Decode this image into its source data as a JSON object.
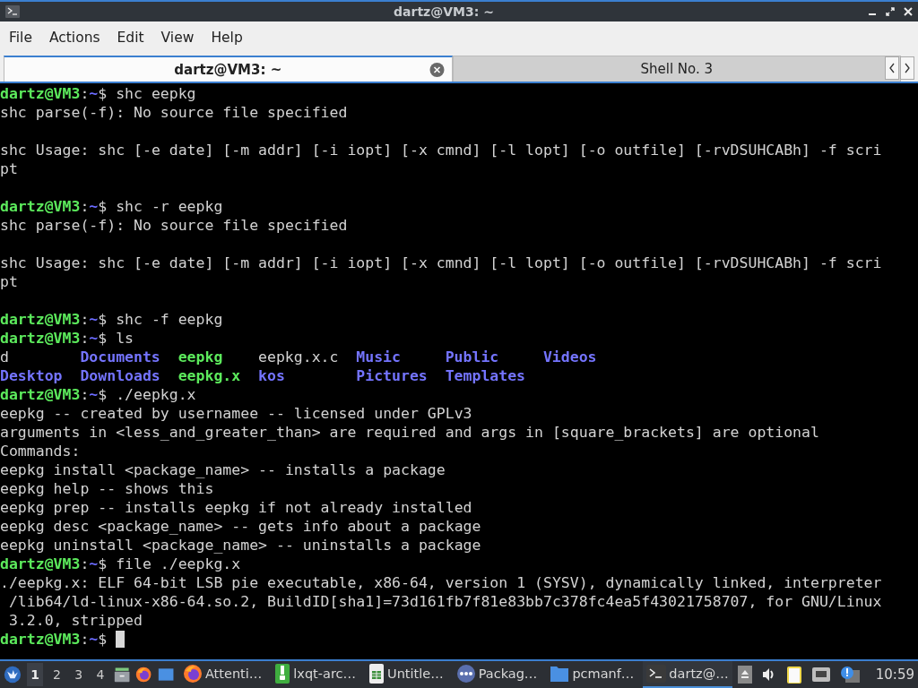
{
  "window": {
    "title": "dartz@VM3: ~"
  },
  "menu": [
    "File",
    "Actions",
    "Edit",
    "View",
    "Help"
  ],
  "tabs": [
    {
      "label": "dartz@VM3: ~",
      "selected": true
    },
    {
      "label": "Shell No. 3",
      "selected": false
    }
  ],
  "terminal": {
    "lines": [
      {
        "kind": "text",
        "segments": [
          {
            "t": "dartz@VM3",
            "kind": "user"
          },
          {
            "t": ":",
            "kind": "plain"
          },
          {
            "t": "~",
            "kind": "path"
          },
          {
            "t": "$ shc eepkg",
            "kind": "plain"
          }
        ]
      },
      {
        "kind": "text",
        "segments": [
          {
            "t": "shc parse(-f): No source file specified",
            "kind": "plain"
          }
        ]
      },
      {
        "kind": "blank"
      },
      {
        "kind": "text",
        "segments": [
          {
            "t": "shc Usage: shc [-e date] [-m addr] [-i iopt] [-x cmnd] [-l lopt] [-o outfile] [-rvDSUHCABh] -f scri",
            "kind": "plain"
          }
        ]
      },
      {
        "kind": "text",
        "segments": [
          {
            "t": "pt",
            "kind": "plain"
          }
        ]
      },
      {
        "kind": "blank"
      },
      {
        "kind": "text",
        "segments": [
          {
            "t": "dartz@VM3",
            "kind": "user"
          },
          {
            "t": ":",
            "kind": "plain"
          },
          {
            "t": "~",
            "kind": "path"
          },
          {
            "t": "$ shc -r eepkg",
            "kind": "plain"
          }
        ]
      },
      {
        "kind": "text",
        "segments": [
          {
            "t": "shc parse(-f): No source file specified",
            "kind": "plain"
          }
        ]
      },
      {
        "kind": "blank"
      },
      {
        "kind": "text",
        "segments": [
          {
            "t": "shc Usage: shc [-e date] [-m addr] [-i iopt] [-x cmnd] [-l lopt] [-o outfile] [-rvDSUHCABh] -f scri",
            "kind": "plain"
          }
        ]
      },
      {
        "kind": "text",
        "segments": [
          {
            "t": "pt",
            "kind": "plain"
          }
        ]
      },
      {
        "kind": "blank"
      },
      {
        "kind": "text",
        "segments": [
          {
            "t": "dartz@VM3",
            "kind": "user"
          },
          {
            "t": ":",
            "kind": "plain"
          },
          {
            "t": "~",
            "kind": "path"
          },
          {
            "t": "$ shc -f eepkg",
            "kind": "plain"
          }
        ]
      },
      {
        "kind": "text",
        "segments": [
          {
            "t": "dartz@VM3",
            "kind": "user"
          },
          {
            "t": ":",
            "kind": "plain"
          },
          {
            "t": "~",
            "kind": "path"
          },
          {
            "t": "$ ls",
            "kind": "plain"
          }
        ]
      },
      {
        "kind": "columns",
        "segments": [
          {
            "t": "d",
            "kind": "plain"
          },
          {
            "t": "Documents",
            "kind": "dir"
          },
          {
            "t": "eepkg",
            "kind": "exec"
          },
          {
            "t": "eepkg.x.c",
            "kind": "plain"
          },
          {
            "t": "Music",
            "kind": "dir"
          },
          {
            "t": "Public",
            "kind": "dir"
          },
          {
            "t": "Videos",
            "kind": "dir"
          }
        ]
      },
      {
        "kind": "columns",
        "segments": [
          {
            "t": "Desktop",
            "kind": "dir"
          },
          {
            "t": "Downloads",
            "kind": "dir"
          },
          {
            "t": "eepkg.x",
            "kind": "exec"
          },
          {
            "t": "kos",
            "kind": "dir"
          },
          {
            "t": "Pictures",
            "kind": "dir"
          },
          {
            "t": "Templates",
            "kind": "dir"
          }
        ]
      },
      {
        "kind": "text",
        "segments": [
          {
            "t": "dartz@VM3",
            "kind": "user"
          },
          {
            "t": ":",
            "kind": "plain"
          },
          {
            "t": "~",
            "kind": "path"
          },
          {
            "t": "$ ./eepkg.x",
            "kind": "plain"
          }
        ]
      },
      {
        "kind": "text",
        "segments": [
          {
            "t": "eepkg -- created by usernamee -- licensed under GPLv3",
            "kind": "plain"
          }
        ]
      },
      {
        "kind": "text",
        "segments": [
          {
            "t": "arguments in <less_and_greater_than> are required and args in [square_brackets] are optional",
            "kind": "plain"
          }
        ]
      },
      {
        "kind": "text",
        "segments": [
          {
            "t": "Commands:",
            "kind": "plain"
          }
        ]
      },
      {
        "kind": "text",
        "segments": [
          {
            "t": "eepkg install <package_name> -- installs a package",
            "kind": "plain"
          }
        ]
      },
      {
        "kind": "text",
        "segments": [
          {
            "t": "eepkg help -- shows this",
            "kind": "plain"
          }
        ]
      },
      {
        "kind": "text",
        "segments": [
          {
            "t": "eepkg prep -- installs eepkg if not already installed",
            "kind": "plain"
          }
        ]
      },
      {
        "kind": "text",
        "segments": [
          {
            "t": "eepkg desc <package_name> -- gets info about a package",
            "kind": "plain"
          }
        ]
      },
      {
        "kind": "text",
        "segments": [
          {
            "t": "eepkg uninstall <package_name> -- uninstalls a package",
            "kind": "plain"
          }
        ]
      },
      {
        "kind": "text",
        "segments": [
          {
            "t": "dartz@VM3",
            "kind": "user"
          },
          {
            "t": ":",
            "kind": "plain"
          },
          {
            "t": "~",
            "kind": "path"
          },
          {
            "t": "$ file ./eepkg.x",
            "kind": "plain"
          }
        ]
      },
      {
        "kind": "text",
        "segments": [
          {
            "t": "./eepkg.x: ELF 64-bit LSB pie executable, x86-64, version 1 (SYSV), dynamically linked, interpreter",
            "kind": "plain"
          }
        ]
      },
      {
        "kind": "text",
        "segments": [
          {
            "t": " /lib64/ld-linux-x86-64.so.2, BuildID[sha1]=73d161fb7f81e83bb7c378fc4ea5f43021758707, for GNU/Linux",
            "kind": "plain"
          }
        ]
      },
      {
        "kind": "text",
        "segments": [
          {
            "t": " 3.2.0, stripped",
            "kind": "plain"
          }
        ]
      },
      {
        "kind": "text",
        "cursor": true,
        "segments": [
          {
            "t": "dartz@VM3",
            "kind": "user"
          },
          {
            "t": ":",
            "kind": "plain"
          },
          {
            "t": "~",
            "kind": "path"
          },
          {
            "t": "$ ",
            "kind": "plain"
          }
        ]
      }
    ]
  },
  "taskbar": {
    "desktops": [
      {
        "label": "1",
        "selected": true
      },
      {
        "label": "2",
        "selected": false
      },
      {
        "label": "3",
        "selected": false
      },
      {
        "label": "4",
        "selected": false
      }
    ],
    "tasks": [
      {
        "label": "Attenti…",
        "kind": "firefox",
        "selected": false
      },
      {
        "label": "lxqt-arc…",
        "kind": "archive",
        "selected": false
      },
      {
        "label": "Untitle…",
        "kind": "spreadsheet",
        "selected": false
      },
      {
        "label": "Packag…",
        "kind": "dots",
        "selected": false
      },
      {
        "label": "pcmanf…",
        "kind": "folder",
        "selected": false
      },
      {
        "label": "dartz@…",
        "kind": "terminal",
        "selected": true
      }
    ],
    "clock": "10:59"
  }
}
